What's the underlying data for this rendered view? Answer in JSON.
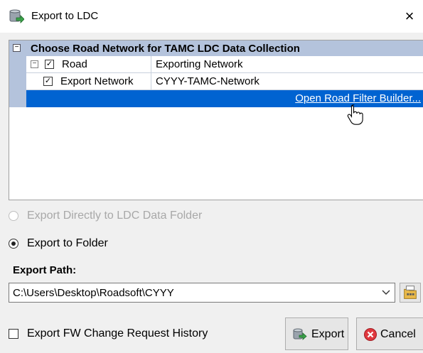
{
  "window": {
    "title": "Export to LDC",
    "close_glyph": "×"
  },
  "grid": {
    "category_label": "Choose Road Network for TAMC LDC Data Collection",
    "rows": [
      {
        "name": "Road",
        "value": "Exporting Network",
        "checked": true,
        "expandable": true
      },
      {
        "name": "Export Network",
        "value": "CYYY-TAMC-Network",
        "checked": true,
        "expandable": false
      }
    ],
    "link_label": "Open Road Filter Builder..."
  },
  "options": {
    "direct_label": "Export Directly to LDC Data Folder",
    "folder_label": "Export to Folder",
    "selected": "folder"
  },
  "export_path": {
    "label": "Export Path:",
    "value": "C:\\Users\\Desktop\\Roadsoft\\CYYY"
  },
  "history_checkbox": {
    "label": "Export FW Change Request History",
    "checked": false
  },
  "buttons": {
    "export_label": "Export",
    "cancel_label": "Cancel"
  },
  "icons": {
    "title": "export-database-icon",
    "browse": "folder-browse-icon",
    "export": "export-database-icon",
    "cancel": "cancel-icon",
    "cursor": "hand-pointer-icon"
  },
  "colors": {
    "category_bg": "#b4c3dc",
    "selected_row": "#0063d1",
    "cancel_red": "#e0383e"
  }
}
